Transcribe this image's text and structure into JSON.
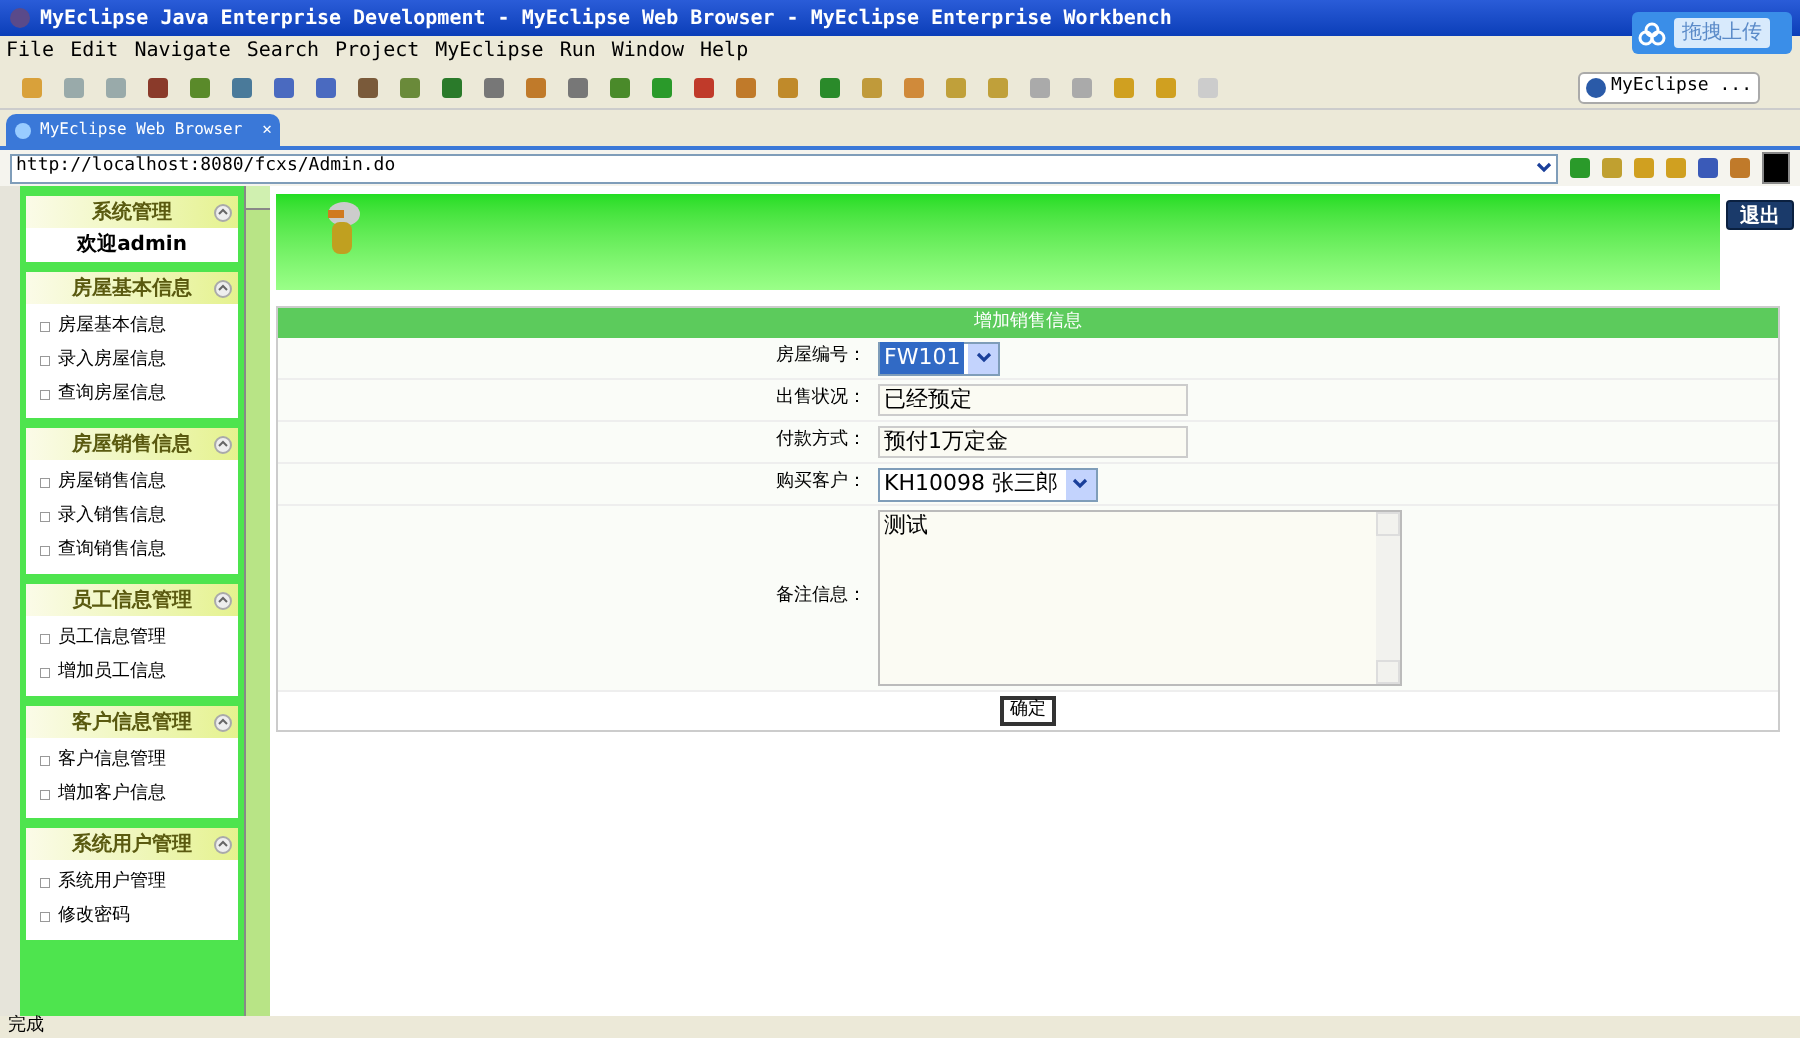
{
  "window": {
    "title": "MyEclipse Java Enterprise Development - MyEclipse Web Browser - MyEclipse Enterprise Workbench"
  },
  "menu": [
    "File",
    "Edit",
    "Navigate",
    "Search",
    "Project",
    "MyEclipse",
    "Run",
    "Window",
    "Help"
  ],
  "perspective": {
    "label": "MyEclipse ..."
  },
  "upload_widget": {
    "label": "拖拽上传"
  },
  "editor_tab": {
    "label": "MyEclipse Web Browser",
    "close": "✕"
  },
  "address": {
    "value": "http://localhost:8080/fcxs/Admin.do"
  },
  "sidebar": {
    "sections": [
      {
        "title": "系统管理",
        "welcome": "欢迎admin"
      },
      {
        "title": "房屋基本信息",
        "items": [
          "房屋基本信息",
          "录入房屋信息",
          "查询房屋信息"
        ]
      },
      {
        "title": "房屋销售信息",
        "items": [
          "房屋销售信息",
          "录入销售信息",
          "查询销售信息"
        ]
      },
      {
        "title": "员工信息管理",
        "items": [
          "员工信息管理",
          "增加员工信息"
        ]
      },
      {
        "title": "客户信息管理",
        "items": [
          "客户信息管理",
          "增加客户信息"
        ]
      },
      {
        "title": "系统用户管理",
        "items": [
          "系统用户管理",
          "修改密码"
        ]
      }
    ]
  },
  "logout_button": {
    "label": "退出"
  },
  "form": {
    "title": "增加销售信息",
    "fields": [
      {
        "kind": "select",
        "label": "房屋编号：",
        "value": "FW101",
        "highlighted": true
      },
      {
        "kind": "text",
        "label": "出售状况：",
        "value": "已经预定"
      },
      {
        "kind": "text",
        "label": "付款方式：",
        "value": "预付1万定金"
      },
      {
        "kind": "select",
        "label": "购买客户：",
        "value": "KH10098 张三郎",
        "highlighted": false
      },
      {
        "kind": "textarea",
        "label": "备注信息：",
        "value": "测试"
      }
    ],
    "submit": "确定"
  },
  "status_bar": {
    "text": "完成"
  }
}
